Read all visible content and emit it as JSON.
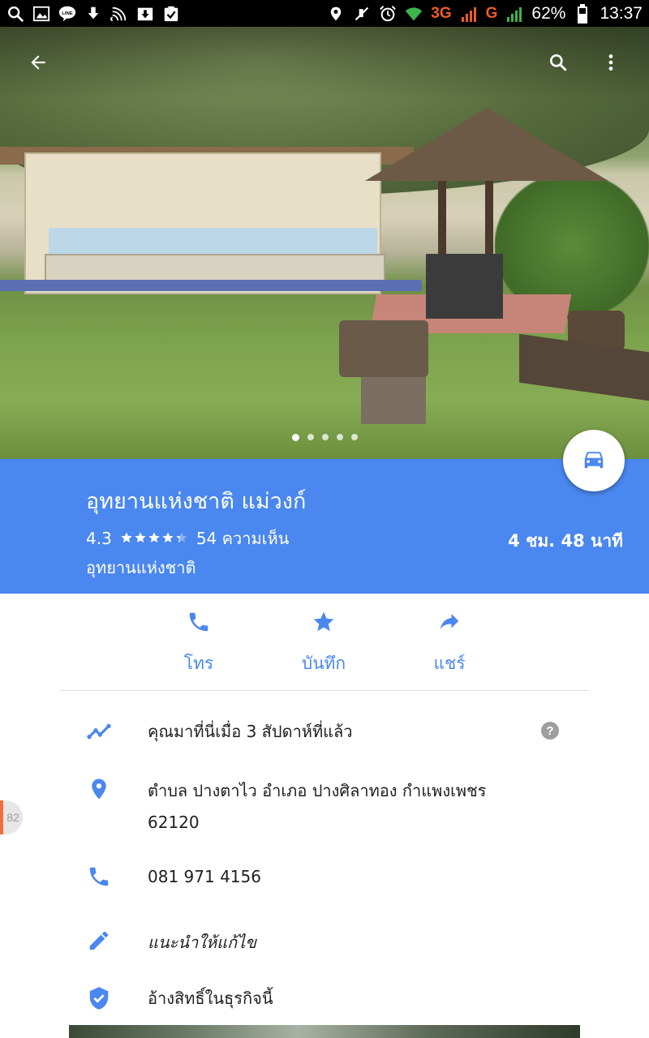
{
  "status_bar": {
    "left_icons": [
      "search-icon",
      "image-icon",
      "line-app-icon",
      "download-icon",
      "cast-icon",
      "download-box-icon",
      "clipboard-check-icon"
    ],
    "right_icons": [
      "location-icon",
      "mute-icon",
      "alarm-icon",
      "wifi-icon"
    ],
    "network_1": "3G",
    "network_2": "G",
    "battery": "62%",
    "time": "13:37"
  },
  "hero": {
    "photo_count": 5,
    "active_photo_index": 0,
    "icons": {
      "back": "arrow-back-icon",
      "search": "search-icon",
      "more": "more-vert-icon"
    }
  },
  "fab": {
    "icon": "car-icon"
  },
  "place": {
    "title": "อุทยานแห่งชาติ แม่วงก์",
    "rating": "4.3",
    "stars_value": 4.3,
    "reviews": "54 ความเห็น",
    "category": "อุทยานแห่งชาติ",
    "travel_time": "4 ชม. 48 นาที"
  },
  "actions": [
    {
      "label": "โทร",
      "icon": "phone-icon"
    },
    {
      "label": "บันทึก",
      "icon": "star-icon"
    },
    {
      "label": "แชร์",
      "icon": "share-icon"
    }
  ],
  "details": {
    "visited": "คุณมาที่นี่เมื่อ 3 สัปดาห์ที่แล้ว",
    "address_line1": "ตำบล ปางตาไว อำเภอ ปางศิลาทอง กำแพงเพชร",
    "address_line2": "62120",
    "phone": "081 971 4156",
    "suggest_edit": "แนะนำให้แก้ไข",
    "claim_business": "อ้างสิทธิ์ในธุรกิจนี้"
  },
  "side_badge": "82",
  "colors": {
    "accent": "#4a87ee",
    "panel": "#4a87ee",
    "network": "#f05a28"
  }
}
